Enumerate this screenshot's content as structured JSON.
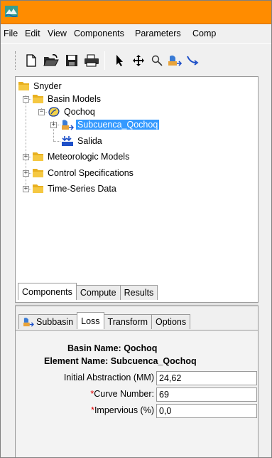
{
  "colors": {
    "titlebar": "#ff8c00",
    "selection": "#3399ff",
    "required": "#e00000"
  },
  "menu": [
    "File",
    "Edit",
    "View",
    "Components",
    "Parameters",
    "Comp"
  ],
  "toolbar": {
    "buttons": [
      "new-file-icon",
      "open-folder-icon",
      "save-icon",
      "print-icon",
      "arrow-pointer-icon",
      "move-pan-icon",
      "zoom-icon",
      "subbasin-tool-icon",
      "reach-tool-icon"
    ]
  },
  "tree": {
    "root": "Snyder",
    "basin_models": "Basin Models",
    "basin": "Qochoq",
    "subbasin": "Subcuenca_Qochoq",
    "sink": "Salida",
    "meteorologic": "Meteorologic Models",
    "control": "Control Specifications",
    "timeseries": "Time-Series Data"
  },
  "lower_tabs": [
    "Components",
    "Compute",
    "Results"
  ],
  "prop_tabs": [
    "Subbasin",
    "Loss",
    "Transform",
    "Options"
  ],
  "info": {
    "basin_name": "Basin Name: Qochoq",
    "element_name": "Element Name: Subcuenca_Qochoq"
  },
  "fields": {
    "initial_abstraction": {
      "label": "Initial Abstraction (MM)",
      "value": "24,62"
    },
    "curve_number": {
      "required": "*",
      "label": "Curve Number:",
      "value": "69"
    },
    "impervious": {
      "required": "*",
      "label": "Impervious (%)",
      "value": "0,0"
    }
  }
}
